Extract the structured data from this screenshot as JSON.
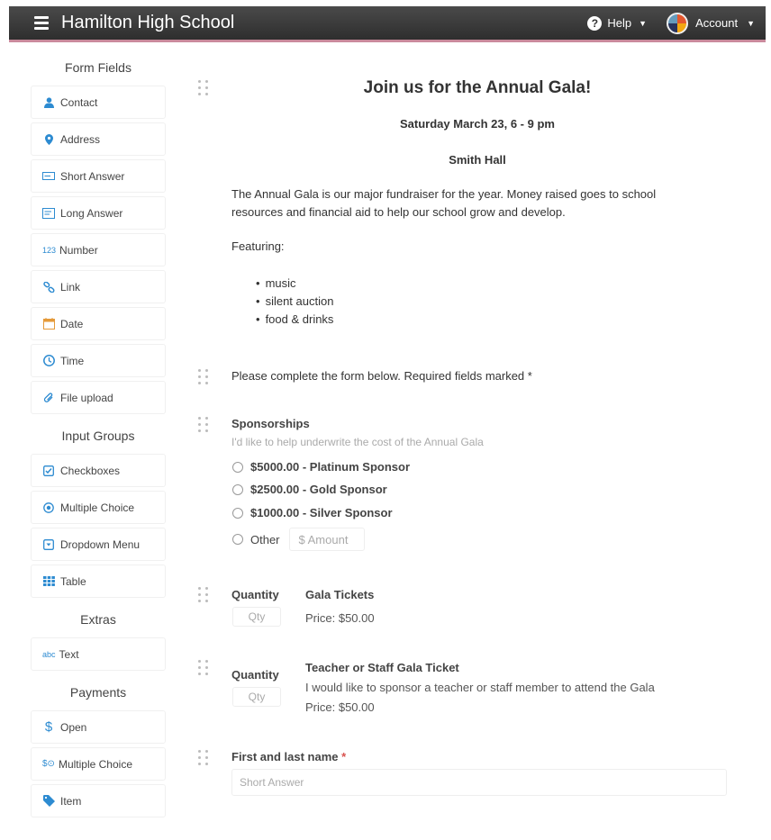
{
  "header": {
    "title": "Hamilton High School",
    "help_label": "Help",
    "account_label": "Account"
  },
  "sidebar": {
    "form_fields_heading": "Form Fields",
    "form_fields": [
      {
        "label": "Contact",
        "icon": "person-icon"
      },
      {
        "label": "Address",
        "icon": "map-pin-icon"
      },
      {
        "label": "Short Answer",
        "icon": "short-answer-icon"
      },
      {
        "label": "Long Answer",
        "icon": "long-answer-icon"
      },
      {
        "label": "Number",
        "icon": "number-icon",
        "glyph": "123"
      },
      {
        "label": "Link",
        "icon": "link-icon"
      },
      {
        "label": "Date",
        "icon": "calendar-icon"
      },
      {
        "label": "Time",
        "icon": "clock-icon"
      },
      {
        "label": "File upload",
        "icon": "paperclip-icon"
      }
    ],
    "input_groups_heading": "Input Groups",
    "input_groups": [
      {
        "label": "Checkboxes",
        "icon": "checkbox-icon"
      },
      {
        "label": "Multiple Choice",
        "icon": "radio-icon"
      },
      {
        "label": "Dropdown Menu",
        "icon": "dropdown-icon"
      },
      {
        "label": "Table",
        "icon": "table-icon"
      }
    ],
    "extras_heading": "Extras",
    "extras": [
      {
        "label": "Text",
        "icon": "text-icon",
        "glyph": "abc"
      }
    ],
    "payments_heading": "Payments",
    "payments": [
      {
        "label": "Open",
        "icon": "dollar-icon",
        "glyph": "$"
      },
      {
        "label": "Multiple Choice",
        "icon": "dollar-radio-icon",
        "glyph": "$⊙"
      },
      {
        "label": "Item",
        "icon": "tag-icon"
      }
    ]
  },
  "form": {
    "title": "Join us for the Annual Gala!",
    "date": "Saturday March 23, 6 - 9 pm",
    "venue": "Smith Hall",
    "description": "The Annual Gala is our major fundraiser for the year. Money raised goes to school resources and financial aid to help our school grow and develop.",
    "featuring_label": "Featuring:",
    "features": [
      "music",
      "silent auction",
      "food & drinks"
    ],
    "instructions": "Please complete the form below. Required fields marked *",
    "sponsorships": {
      "label": "Sponsorships",
      "hint": "I'd like to help underwrite the cost of the Annual Gala",
      "options": [
        "$5000.00 - Platinum Sponsor",
        "$2500.00 - Gold Sponsor",
        "$1000.00 - Silver Sponsor"
      ],
      "other_label": "Other",
      "amount_placeholder": "$  Amount"
    },
    "gala_tickets": {
      "quantity_label": "Quantity",
      "qty_placeholder": "Qty",
      "title": "Gala Tickets",
      "price": "Price: $50.00"
    },
    "staff_ticket": {
      "quantity_label": "Quantity",
      "qty_placeholder": "Qty",
      "title": "Teacher or Staff Gala Ticket",
      "description": "I would like to sponsor a teacher or staff member to attend the Gala",
      "price": "Price: $50.00"
    },
    "name_field": {
      "label": "First and last name",
      "required_mark": "*",
      "placeholder": "Short Answer"
    }
  },
  "colors": {
    "accent_blue": "#2d8bd1",
    "header_bg": "#3a3a3a",
    "required_red": "#d9534f"
  }
}
